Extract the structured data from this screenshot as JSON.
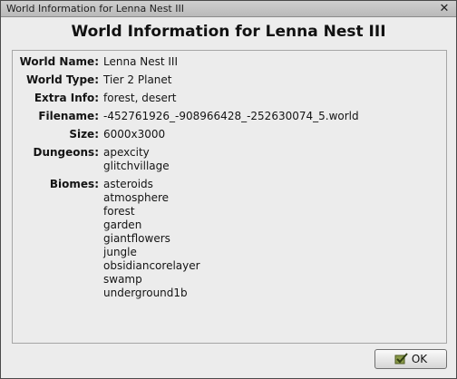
{
  "window": {
    "title": "World Information for Lenna Nest III"
  },
  "heading": "World Information for Lenna Nest III",
  "info": {
    "world_name_label": "World Name:",
    "world_name": "Lenna Nest III",
    "world_type_label": "World Type:",
    "world_type": "Tier 2 Planet",
    "extra_info_label": "Extra Info:",
    "extra_info": "forest, desert",
    "filename_label": "Filename:",
    "filename": "-452761926_-908966428_-252630074_5.world",
    "size_label": "Size:",
    "size": "6000x3000",
    "dungeons_label": "Dungeons:",
    "dungeons": [
      "apexcity",
      "glitchvillage"
    ],
    "biomes_label": "Biomes:",
    "biomes": [
      "asteroids",
      "atmosphere",
      "forest",
      "garden",
      "giantflowers",
      "jungle",
      "obsidiancorelayer",
      "swamp",
      "underground1b"
    ]
  },
  "buttons": {
    "ok_label": "OK",
    "ok_icon": "checkmark-icon"
  }
}
